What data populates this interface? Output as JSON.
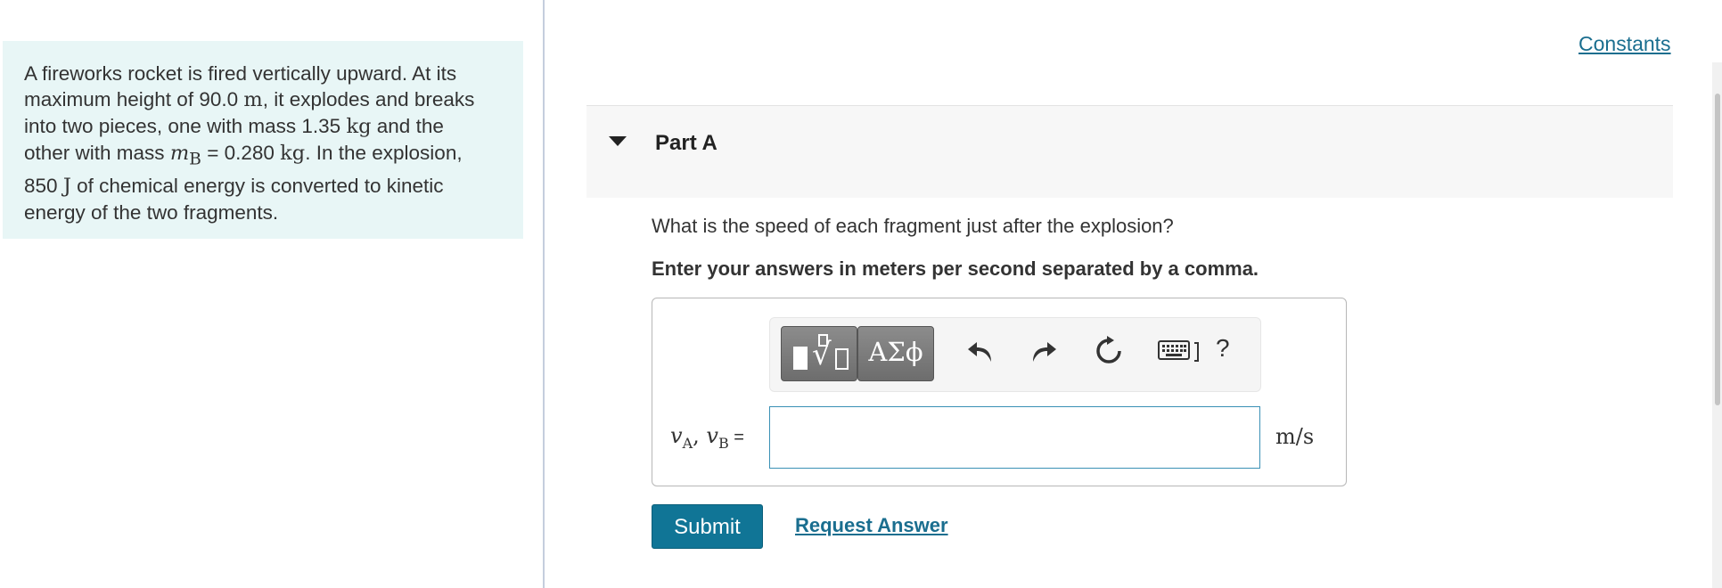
{
  "problem": {
    "l1": "A fireworks rocket is fired vertically upward. At its",
    "l2_a": "maximum height of 90.0",
    "l2_unit": "m",
    "l2_b": ", it explodes and breaks",
    "l3_a": "into two pieces, one with mass 1.35",
    "l3_unit": "kg",
    "l3_b": "and the",
    "l4_a": "other with mass",
    "l4_var": "m",
    "l4_sub": "B",
    "l4_b": " = 0.280",
    "l4_unit": "kg",
    "l4_c": ". In the explosion,",
    "l5_a": "850",
    "l5_unit": "J",
    "l5_b": "of chemical energy is converted to kinetic",
    "l6": "energy of the two fragments."
  },
  "constants_label": "Constants",
  "part": {
    "title": "Part A"
  },
  "question": "What is the speed of each fragment just after the explosion?",
  "instruction": "Enter your answers in meters per second separated by a comma.",
  "toolbar": {
    "symbols_label": "ΑΣϕ",
    "help_label": "?",
    "icons": [
      "templates-icon",
      "symbols-icon",
      "undo-icon",
      "redo-icon",
      "reset-icon",
      "keyboard-icon",
      "help-icon"
    ]
  },
  "answer": {
    "var1": "v",
    "sub1": "A",
    "sep": ", ",
    "var2": "v",
    "sub2": "B",
    "eq": " =",
    "value": "",
    "unit": "m/s"
  },
  "submit_label": "Submit",
  "request_label": "Request Answer",
  "colors": {
    "panel_bg": "#e8f6f6",
    "accent": "#107596",
    "link": "#1a6e8f",
    "input_border": "#3a90b5"
  }
}
